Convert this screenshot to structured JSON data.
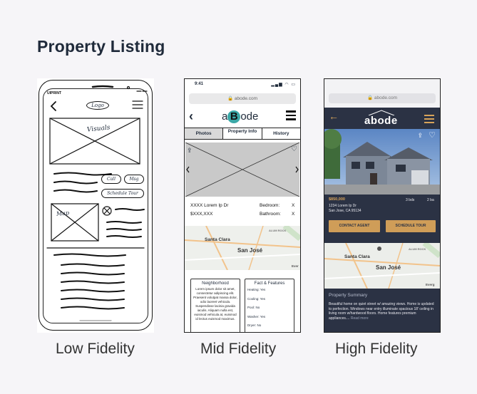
{
  "page": {
    "title": "Property Listing"
  },
  "captions": {
    "low": "Low Fidelity",
    "mid": "Mid Fidelity",
    "high": "High Fidelity"
  },
  "low_fidelity": {
    "carrier": "UIPRINT",
    "logo": "Logo",
    "hero_label": "Visuals",
    "button_call": "Call",
    "button_msg": "Msg",
    "button_schedule": "Schedule Tour",
    "map_label": "Map"
  },
  "mid_fidelity": {
    "time": "9:41",
    "url": "abode.com",
    "logo_pre": "a",
    "logo_mark": "B",
    "logo_post": "ode",
    "tabs": [
      "Photos",
      "Property Info",
      "History"
    ],
    "address": "XXXX Lorem Ip Dr",
    "price": "$XXX,XXX",
    "bedroom_label": "Bedroom:",
    "bedroom_value": "X",
    "bathroom_label": "Bathroom:",
    "bathroom_value": "X",
    "map": {
      "city1": "Santa Clara",
      "city2": "San José",
      "area": "ALUM ROCK",
      "road": "Ever"
    },
    "neighborhood": {
      "title": "Neighborhood",
      "body": "Lorem ipsum dolor sit amet, consectetur adipiscing elit. Praesent volutpat massa dolor, odio laoreet vehicula. Suspendisse lacinia gravida iaculis. Aliquam nulla est, euismod vehicula at, euismod id lectus euismod maximus."
    },
    "facts": {
      "title": "Fact & Features",
      "items": [
        "Heating: Yes",
        "Cooling: Yes",
        "Pool: No",
        "Washer: Yes",
        "Dryer: No"
      ]
    }
  },
  "high_fidelity": {
    "url": "abode.com",
    "logo": "abode",
    "price": "$850,000",
    "address_line1": "1234 Lorem Ip Dr",
    "address_line2": "San Jose, CA 95134",
    "beds": "3 bds",
    "baths": "2 ba",
    "contact_button": "CONTACT AGENT",
    "tour_button": "SCHEDULE TOUR",
    "map": {
      "city1": "Santa Clara",
      "city2": "San José",
      "area": "ALUM ROCK",
      "road": "Everg"
    },
    "summary_title": "Property Summary",
    "summary": "Beautiful home on quiet street w/ amazing views. Home is updated to perfection. Windows near entry illuminate spacious 18' ceiling in living room w/hardwood floors. Home features premium appliances....",
    "read_more": "Read more"
  },
  "colors": {
    "accent": "#cf9d58",
    "dark": "#2b3244",
    "teal": "#3ba8a7"
  }
}
